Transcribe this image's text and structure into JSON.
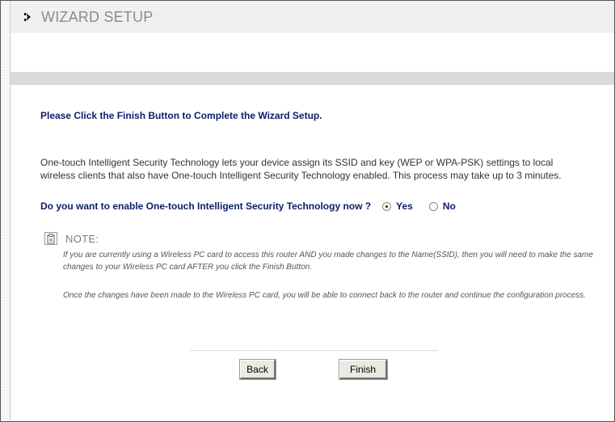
{
  "header": {
    "title": "WIZARD SETUP"
  },
  "main": {
    "heading": "Please Click the Finish Button to Complete the Wizard Setup.",
    "description": "One-touch Intelligent Security Technology lets your device assign its SSID and key (WEP or WPA-PSK) settings to local wireless clients that also have One-touch Intelligent Security Technology enabled. This process may take up to 3 minutes.",
    "question": "Do you want to enable One-touch Intelligent Security Technology now ?",
    "options": [
      {
        "label": "Yes",
        "checked": true
      },
      {
        "label": "No",
        "checked": false
      }
    ]
  },
  "note": {
    "title": "NOTE:",
    "paragraph1": "If you are currently using a Wireless PC card to access this router AND you made changes to the Name(SSID), then you will need to make the same changes to your Wireless PC card AFTER you click the Finish Button.",
    "paragraph2": "Once the changes have been made to the Wireless PC card, you will be able to connect back to the router and continue the configuration process."
  },
  "buttons": {
    "back_label": "Back",
    "finish_label": "Finish"
  },
  "icons": {
    "header": "arrow-right-icon",
    "note": "notepad-icon"
  }
}
